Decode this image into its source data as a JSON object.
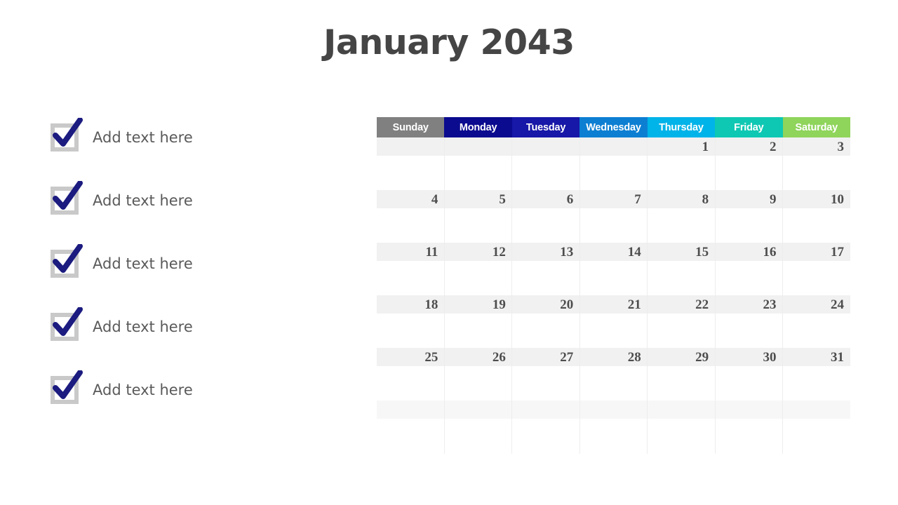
{
  "title": "January 2043",
  "checklist": {
    "items": [
      {
        "label": "Add text here",
        "icon": "checkbox-checked-icon"
      },
      {
        "label": "Add text here",
        "icon": "checkbox-checked-icon"
      },
      {
        "label": "Add text here",
        "icon": "checkbox-checked-icon"
      },
      {
        "label": "Add text here",
        "icon": "checkbox-checked-icon"
      },
      {
        "label": "Add text here",
        "icon": "checkbox-checked-icon"
      }
    ]
  },
  "calendar": {
    "month": "January",
    "year": "2043",
    "weekday_headers": [
      {
        "label": "Sunday",
        "color": "#808080"
      },
      {
        "label": "Monday",
        "color": "#0b0b8f"
      },
      {
        "label": "Tuesday",
        "color": "#1717a8"
      },
      {
        "label": "Wednesday",
        "color": "#0c7fd2"
      },
      {
        "label": "Thursday",
        "color": "#00b3e8"
      },
      {
        "label": "Friday",
        "color": "#0fc8b3"
      },
      {
        "label": "Saturday",
        "color": "#8fd45b"
      }
    ],
    "weeks": [
      [
        "",
        "",
        "",
        "",
        "1",
        "2",
        "3"
      ],
      [
        "4",
        "5",
        "6",
        "7",
        "8",
        "9",
        "10"
      ],
      [
        "11",
        "12",
        "13",
        "14",
        "15",
        "16",
        "17"
      ],
      [
        "18",
        "19",
        "20",
        "21",
        "22",
        "23",
        "24"
      ],
      [
        "25",
        "26",
        "27",
        "28",
        "29",
        "30",
        "31"
      ],
      [
        "",
        "",
        "",
        "",
        "",
        "",
        ""
      ]
    ],
    "colors": {
      "date_band": "#f1f1f1",
      "date_band_last": "#f7f7f7",
      "grid_line": "#ededed",
      "date_text": "#4d4d4d",
      "header_text": "#ffffff"
    }
  },
  "theme": {
    "background": "#ffffff",
    "title_color": "#454545",
    "checkbox_border": "#c9c9c9",
    "checkmark_color": "#1b1b80",
    "label_color": "#5a5a5a"
  }
}
